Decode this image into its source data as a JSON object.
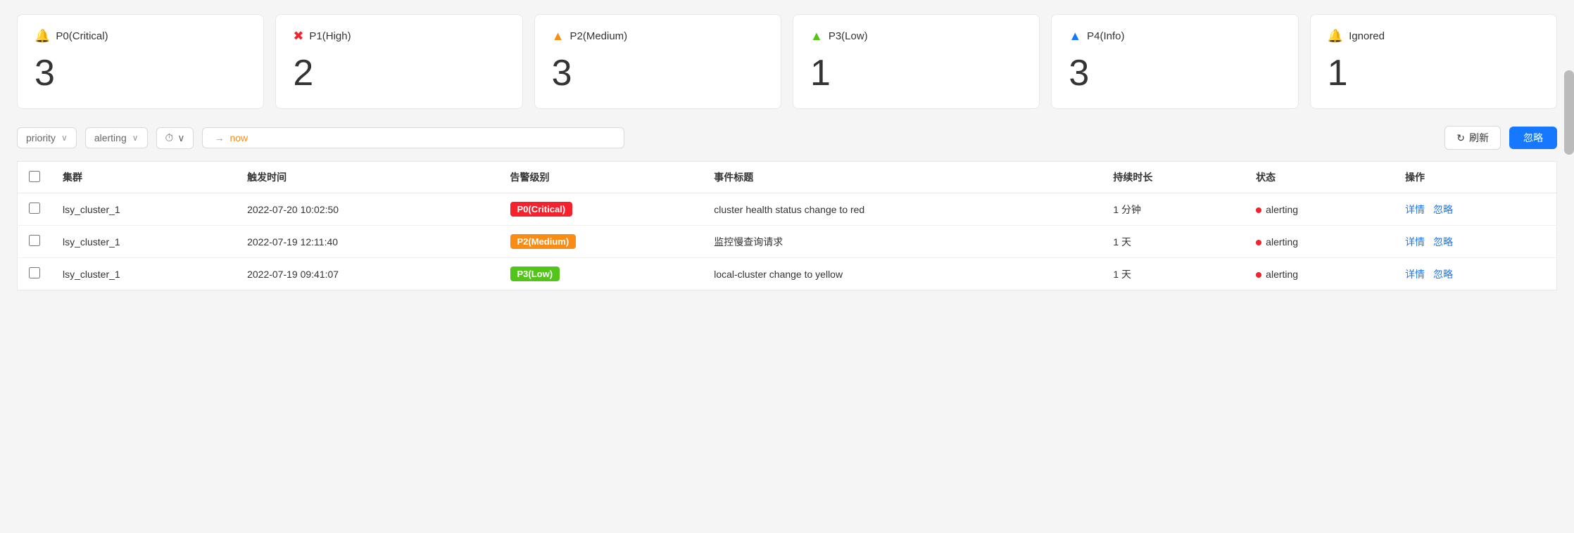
{
  "summary_cards": [
    {
      "id": "p0",
      "icon": "🔔",
      "icon_color": "#f5222d",
      "label": "P0(Critical)",
      "count": "3"
    },
    {
      "id": "p1",
      "icon": "✖",
      "icon_color": "#f5222d",
      "label": "P1(High)",
      "count": "2"
    },
    {
      "id": "p2",
      "icon": "▲",
      "icon_color": "#fa8c16",
      "label": "P2(Medium)",
      "count": "3"
    },
    {
      "id": "p3",
      "icon": "▲",
      "icon_color": "#52c41a",
      "label": "P3(Low)",
      "count": "1"
    },
    {
      "id": "p4",
      "icon": "▲",
      "icon_color": "#1677ff",
      "label": "P4(Info)",
      "count": "3"
    },
    {
      "id": "ignored",
      "icon": "🔔",
      "icon_color": "#fa8c16",
      "label": "Ignored",
      "count": "1"
    }
  ],
  "filters": {
    "priority_label": "priority",
    "priority_placeholder": "priority",
    "status_label": "alerting",
    "time_label": "now",
    "refresh_label": "刷新",
    "ignore_label": "忽略"
  },
  "table": {
    "columns": [
      "",
      "集群",
      "触发时间",
      "告警级别",
      "事件标题",
      "持续时长",
      "状态",
      "操作"
    ],
    "rows": [
      {
        "cluster": "lsy_cluster_1",
        "trigger_time": "2022-07-20 10:02:50",
        "priority": "P0(Critical)",
        "priority_class": "badge-p0",
        "title": "cluster health status change to red",
        "duration": "1 分钟",
        "status": "alerting",
        "action_detail": "详情",
        "action_ignore": "忽略"
      },
      {
        "cluster": "lsy_cluster_1",
        "trigger_time": "2022-07-19 12:11:40",
        "priority": "P2(Medium)",
        "priority_class": "badge-p2",
        "title": "监控慢查询请求",
        "duration": "1 天",
        "status": "alerting",
        "action_detail": "详情",
        "action_ignore": "忽略"
      },
      {
        "cluster": "lsy_cluster_1",
        "trigger_time": "2022-07-19 09:41:07",
        "priority": "P3(Low)",
        "priority_class": "badge-p3",
        "title": "local-cluster change to yellow",
        "duration": "1 天",
        "status": "alerting",
        "action_detail": "详情",
        "action_ignore": "忽略"
      }
    ]
  }
}
